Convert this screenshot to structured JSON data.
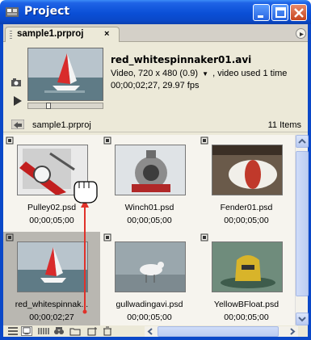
{
  "window": {
    "title": "Project",
    "icon": "project-panel-icon"
  },
  "tab": {
    "label": "sample1.prproj",
    "close_glyph": "×"
  },
  "preview": {
    "clip_name": "red_whitespinnaker01.avi",
    "info_line1_a": "Video, 720 x 480 (0.9)",
    "info_line1_b": ", video used 1 time",
    "info_line2": "00;00;02;27, 29.97 fps"
  },
  "bin": {
    "path": "sample1.prproj",
    "count": "11 Items"
  },
  "items": [
    {
      "name": "Pulley02.psd",
      "duration": "00;00;05;00"
    },
    {
      "name": "Winch01.psd",
      "duration": "00;00;05;00"
    },
    {
      "name": "Fender01.psd",
      "duration": "00;00;05;00"
    },
    {
      "name": "red_whitespinnak...",
      "duration": "00;00;02;27"
    },
    {
      "name": "gullwadingavi.psd",
      "duration": "00;00;05;00"
    },
    {
      "name": "YellowBFloat.psd",
      "duration": "00;00;05;00"
    }
  ],
  "colors": {
    "titlebar": "#0a4fd6",
    "drag_arrow": "#e0322a",
    "selected_cell": "#b9b7b1"
  }
}
